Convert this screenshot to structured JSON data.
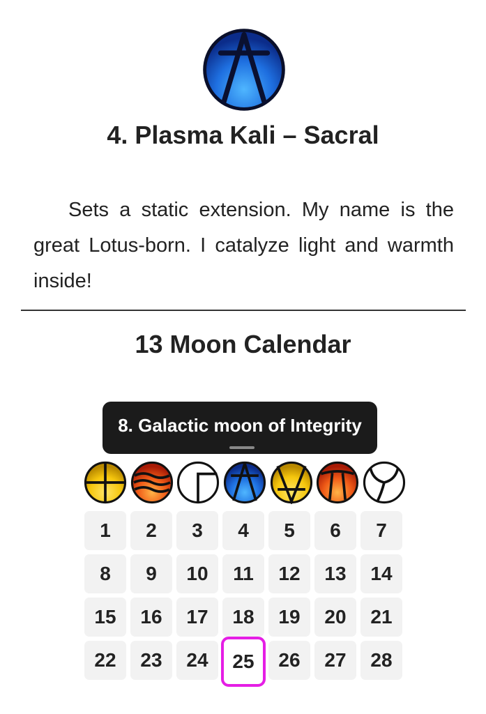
{
  "plasma": {
    "title": "4. Plasma Kali – Sacral",
    "description": "Sets a static extension. My name is the great Lotus-born. I catalyze light and warmth inside!",
    "icon": "kali-plasma-icon"
  },
  "calendar": {
    "title": "13 Moon Calendar",
    "moon_tooltip": "8. Galactic moon of Integrity",
    "selected_day": "25",
    "plasmas": [
      {
        "icon": "dali-plasma-icon",
        "color": "#f4c20d"
      },
      {
        "icon": "seli-plasma-icon",
        "color": "#e2461c"
      },
      {
        "icon": "gamma-plasma-icon",
        "color": "#ffffff"
      },
      {
        "icon": "kali-plasma-icon",
        "color": "#1f6ed8"
      },
      {
        "icon": "alpha-plasma-icon",
        "color": "#f4c20d"
      },
      {
        "icon": "limi-plasma-icon",
        "color": "#e2461c"
      },
      {
        "icon": "silio-plasma-icon",
        "color": "#ffffff"
      }
    ],
    "days": [
      "1",
      "2",
      "3",
      "4",
      "5",
      "6",
      "7",
      "8",
      "9",
      "10",
      "11",
      "12",
      "13",
      "14",
      "15",
      "16",
      "17",
      "18",
      "19",
      "20",
      "21",
      "22",
      "23",
      "24",
      "25",
      "26",
      "27",
      "28"
    ]
  },
  "colors": {
    "highlight": "#e51ee5",
    "tooltip_bg": "#1b1b1b",
    "cell_bg": "#f2f2f2"
  }
}
